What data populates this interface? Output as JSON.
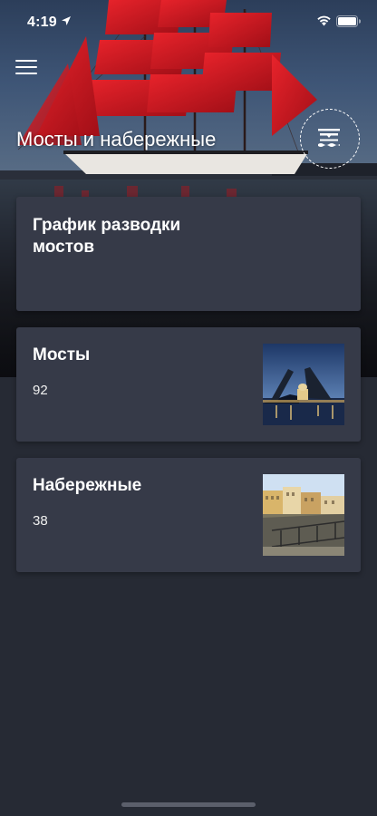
{
  "status_bar": {
    "time": "4:19"
  },
  "header": {
    "title": "Мосты и набережные"
  },
  "cards": {
    "schedule": {
      "title": "График разводки мостов"
    },
    "bridges": {
      "title": "Мосты",
      "count": "92"
    },
    "embankments": {
      "title": "Набережные",
      "count": "38"
    }
  },
  "colors": {
    "background": "#262a34",
    "card": "#363a48",
    "sail_red": "#d21a22",
    "text": "#ffffff"
  },
  "icons": {
    "menu": "hamburger-menu-icon",
    "toggle": "drawbridge-icon",
    "status": [
      "location-arrow-icon",
      "wifi-icon",
      "battery-icon"
    ]
  }
}
